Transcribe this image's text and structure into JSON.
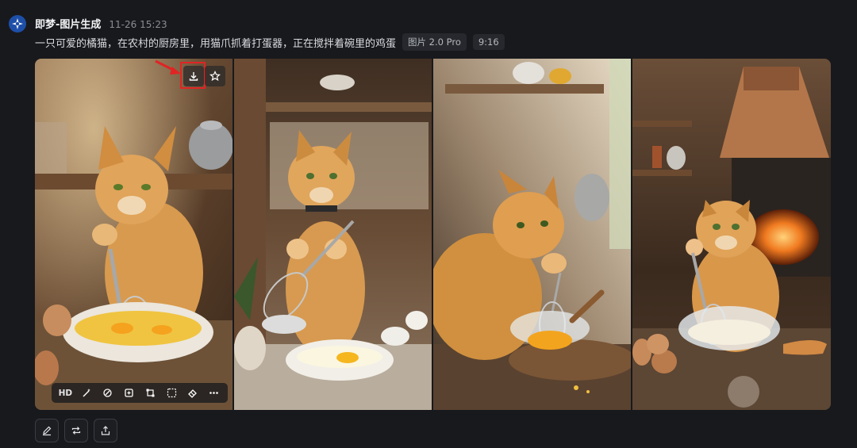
{
  "message": {
    "app_name": "即梦-图片生成",
    "timestamp": "11-26 15:23",
    "prompt": "一只可爱的橘猫，在农村的厨房里，用猫爪抓着打蛋器，正在搅拌着碗里的鸡蛋",
    "model_tag": "图片 2.0 Pro",
    "ratio_tag": "9:16"
  },
  "images": [
    {
      "label": "cat-whisking-eggs-1"
    },
    {
      "label": "cat-whisking-eggs-2"
    },
    {
      "label": "cat-whisking-eggs-3"
    },
    {
      "label": "cat-whisking-eggs-4"
    }
  ],
  "image_overlay": {
    "download_icon": "download-icon",
    "favorite_icon": "star-icon",
    "highlight_color": "#e02424"
  },
  "image_toolbar": {
    "hd_label": "HD",
    "icons": [
      "magic-wand-icon",
      "retouch-icon",
      "expand-icon",
      "crop-resize-icon",
      "frame-icon",
      "eraser-icon",
      "more-icon"
    ]
  },
  "actions": {
    "icons": [
      "edit-icon",
      "regenerate-icon",
      "share-icon"
    ]
  },
  "colors": {
    "background": "#18191d",
    "tag_background": "#26282d",
    "avatar": "#1e4fa8"
  }
}
